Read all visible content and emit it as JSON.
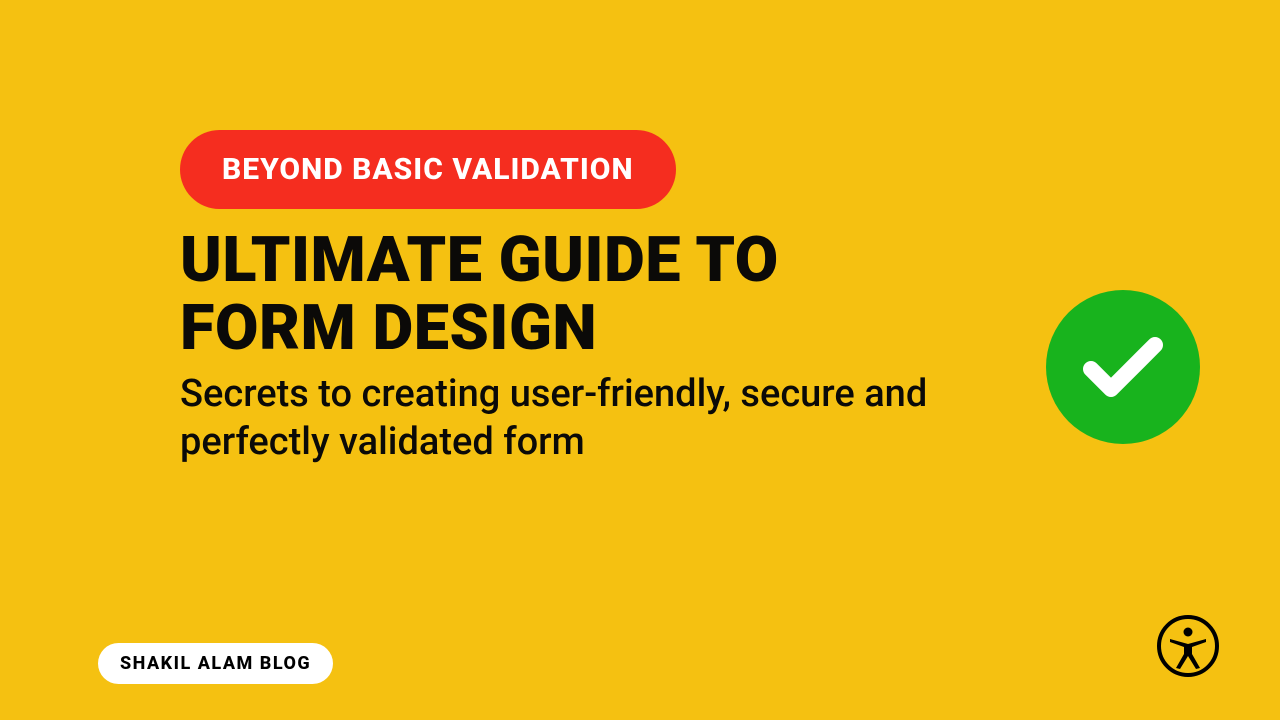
{
  "banner": {
    "kicker": "BEYOND BASIC VALIDATION",
    "title": "ULTIMATE GUIDE TO FORM DESIGN",
    "subtitle": "Secrets to creating user-friendly, secure and perfectly validated form",
    "author_chip": "SHAKIL ALAM BLOG"
  },
  "icons": {
    "check": "checkmark-icon",
    "accessibility": "accessibility-icon"
  },
  "colors": {
    "background": "#f5c111",
    "accent_pill": "#f52d1f",
    "check_badge": "#18b31d",
    "text": "#0b0a08",
    "white": "#ffffff"
  }
}
